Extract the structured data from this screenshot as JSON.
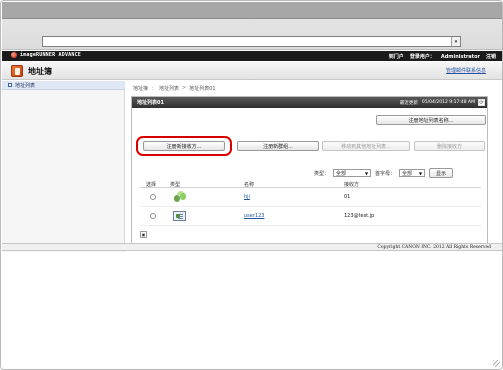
{
  "browser": {
    "address_dropdown_glyph": "▾"
  },
  "topbar": {
    "logo_text": "imageRUNNER ADVANCE",
    "links": [
      {
        "label": "到门户"
      },
      {
        "label": "登录用户："
      },
      {
        "label": "Administrator"
      },
      {
        "label": "注销"
      }
    ]
  },
  "header": {
    "title": "地址簿",
    "manage_link": "管理邮件联系信息"
  },
  "sidebar": {
    "items": [
      {
        "label": "地址列表"
      }
    ]
  },
  "breadcrumb": {
    "items": [
      "地址簿",
      "地址列表",
      "地址列表01"
    ],
    "separator": "：",
    "gt": ">"
  },
  "panel": {
    "title": "地址列表01",
    "last_update_label": "最近更新",
    "last_update_value": "05/04/2012 9:17:48 AM",
    "refresh_icon": "⟳",
    "register_list_name_button": "注册地址列表名称...",
    "buttons": {
      "register_recipient": "注册新接收方...",
      "register_group": "注册新群组...",
      "move_to_other_list": "移动到其他地址列表...",
      "delete_recipient": "删除接收方"
    },
    "filter": {
      "type_label": "类型：",
      "type_value": "全部",
      "initial_label": "首字母：",
      "initial_value": "全部",
      "show_button": "显示"
    },
    "table": {
      "headers": [
        "选择",
        "类型",
        "名称",
        "接收方"
      ],
      "rows": [
        {
          "type": "group",
          "name": "hji",
          "recipient": "01"
        },
        {
          "type": "email",
          "name": "user123",
          "recipient": "123@test.jp"
        }
      ]
    },
    "pager_icon": "▣"
  },
  "footer": {
    "copyright": "Copyright CANON INC. 2012 All Rights Reserved"
  }
}
